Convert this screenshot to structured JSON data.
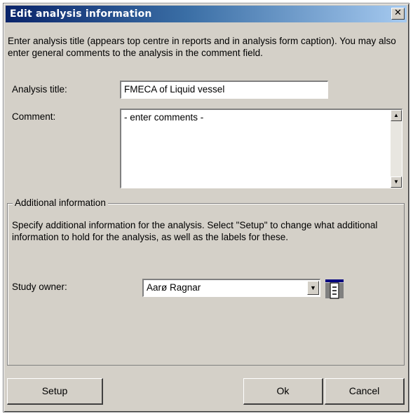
{
  "dialog": {
    "title": "Edit analysis information",
    "close_label": "✕",
    "intro": "Enter analysis title (appears top centre in reports and in analysis form caption). You may also enter general comments to the analysis in the comment field."
  },
  "form": {
    "analysis_title_label": "Analysis title:",
    "analysis_title_value": "FMECA of Liquid vessel",
    "comment_label": "Comment:",
    "comment_value": "- enter comments -"
  },
  "additional": {
    "legend": "Additional information",
    "description": "Specify additional information for the analysis. Select \"Setup\" to change what additional information to hold for the analysis, as well as the labels for these.",
    "study_owner_label": "Study owner:",
    "study_owner_value": "Aarø Ragnar"
  },
  "buttons": {
    "setup": "Setup",
    "ok": "Ok",
    "cancel": "Cancel"
  },
  "icons": {
    "close": "close-icon",
    "scroll_up": "scroll-up-icon",
    "scroll_down": "scroll-down-icon",
    "dropdown": "chevron-down-icon",
    "table": "table-icon"
  },
  "colors": {
    "titlebar_start": "#0a246a",
    "titlebar_end": "#a6caf0",
    "dialog_face": "#d4d0c8"
  }
}
